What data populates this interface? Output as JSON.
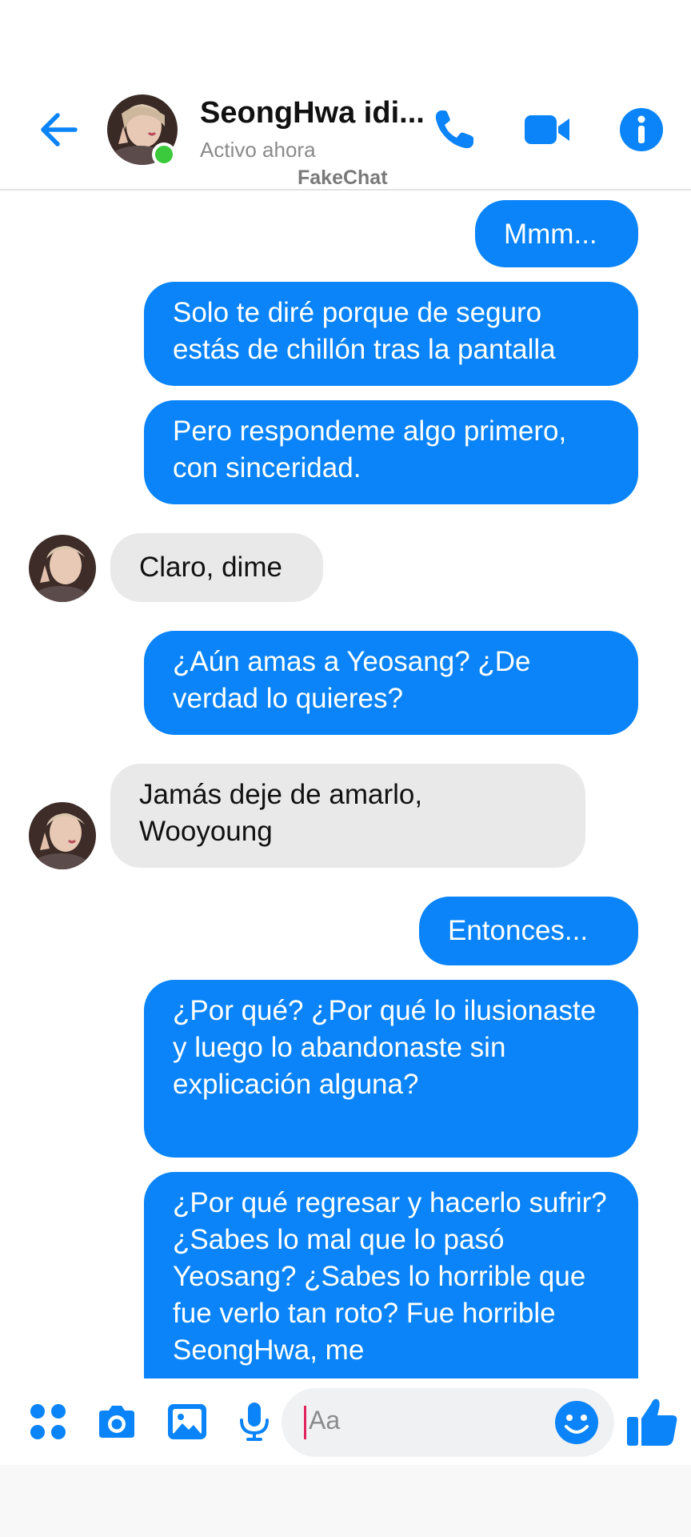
{
  "header": {
    "contact_name": "SeongHwa idi...",
    "status": "Activo ahora",
    "watermark": "FakeChat",
    "icons": [
      "back-arrow-icon",
      "phone-icon",
      "video-camera-icon",
      "info-icon"
    ]
  },
  "messages": [
    {
      "side": "out",
      "text": "Mmm..."
    },
    {
      "side": "out",
      "text": "Solo te diré porque de seguro estás de chillón tras la pantalla"
    },
    {
      "side": "out",
      "text": "Pero respondeme algo primero, con sinceridad."
    },
    {
      "side": "in",
      "text": "Claro, dime"
    },
    {
      "side": "out",
      "text": "¿Aún amas a Yeosang? ¿De verdad lo quieres?"
    },
    {
      "side": "in",
      "text": "Jamás deje de amarlo, Wooyoung"
    },
    {
      "side": "out",
      "text": "Entonces..."
    },
    {
      "side": "out",
      "text": "¿Por qué? ¿Por qué lo ilusionaste y luego lo abandonaste sin explicación alguna?"
    },
    {
      "side": "out",
      "text": "¿Por qué regresar y hacerlo sufrir? ¿Sabes lo mal que lo pasó Yeosang? ¿Sabes lo horrible que fue verlo tan roto? Fue horrible SeongHwa, me"
    }
  ],
  "composer": {
    "placeholder": "Aa",
    "icons": [
      "apps-grid-icon",
      "camera-icon",
      "gallery-icon",
      "microphone-icon",
      "emoji-icon",
      "thumbs-up-icon"
    ]
  },
  "colors": {
    "accent": "#0a84f8",
    "incoming_bubble": "#e9e9ea",
    "online": "#3bca3b"
  }
}
